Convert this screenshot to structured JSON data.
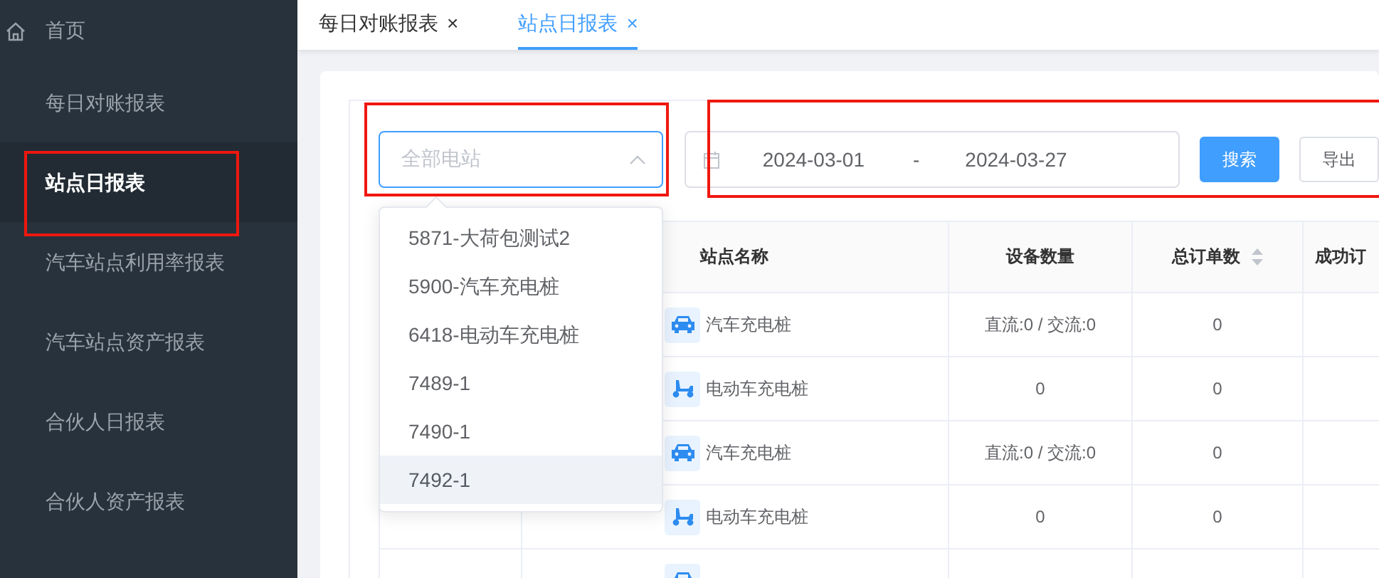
{
  "sidebar": {
    "home": "首页",
    "items": [
      {
        "label": "每日对账报表",
        "selected": false
      },
      {
        "label": "站点日报表",
        "selected": true
      },
      {
        "label": "汽车站点利用率报表",
        "selected": false
      },
      {
        "label": "汽车站点资产报表",
        "selected": false
      },
      {
        "label": "合伙人日报表",
        "selected": false
      },
      {
        "label": "合伙人资产报表",
        "selected": false
      }
    ]
  },
  "tabs": [
    {
      "label": "每日对账报表",
      "close": "×",
      "selected": false
    },
    {
      "label": "站点日报表",
      "close": "×",
      "selected": true
    }
  ],
  "filters": {
    "station_select": {
      "placeholder": "全部电站",
      "expanded": true,
      "options": [
        {
          "label": "5871-大荷包测试2",
          "hovered": false
        },
        {
          "label": "5900-汽车充电桩",
          "hovered": false
        },
        {
          "label": "6418-电动车充电桩",
          "hovered": false
        },
        {
          "label": "7489-1",
          "hovered": false
        },
        {
          "label": "7490-1",
          "hovered": false
        },
        {
          "label": "7492-1",
          "hovered": true
        }
      ]
    },
    "date_start": "2024-03-01",
    "date_separator": "-",
    "date_end": "2024-03-27",
    "buttons": [
      {
        "label": "搜索",
        "kind": "primary"
      },
      {
        "label": "导出",
        "kind": "default"
      }
    ]
  },
  "table": {
    "columns": [
      {
        "label": "站点名称",
        "sortable": false
      },
      {
        "label": "设备数量",
        "sortable": false
      },
      {
        "label": "总订单数",
        "sortable": true
      },
      {
        "label": "成功订",
        "sortable": false
      }
    ],
    "rows": [
      {
        "station": "汽车充电桩",
        "kind": "car",
        "devices": "直流:0 / 交流:0",
        "orders": "0"
      },
      {
        "station": "电动车充电桩",
        "kind": "ebike",
        "devices": "0",
        "orders": "0"
      },
      {
        "station": "汽车充电桩",
        "kind": "car",
        "devices": "直流:0 / 交流:0",
        "orders": "0"
      },
      {
        "station": "电动车充电桩",
        "kind": "ebike",
        "devices": "0",
        "orders": "0"
      },
      {
        "kind": "car"
      }
    ]
  }
}
